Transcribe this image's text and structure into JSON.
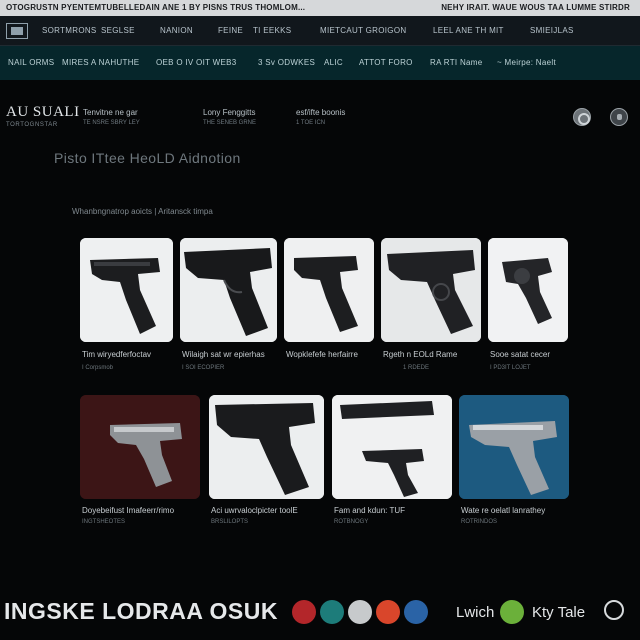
{
  "topbar": {
    "left_text": "OTOGRUSTN PYENTEMTUBELLEDAIN ANE 1 BY PISNS TRUS THOMLOM...",
    "right_text": "NEHY IRAIT.  WAUE WOUS TAA LUMME STIRDR"
  },
  "nav_primary": {
    "logo_icon": "site-logo-icon",
    "items": [
      "SORTMRONS",
      "SEGLSE",
      "NANION",
      "FEINE",
      "TI EEKKS",
      "MIETCAUT GROIGON",
      "LEEL ANE TH MIT",
      "SMIEIJLAS"
    ]
  },
  "nav_secondary": {
    "items": [
      "NAIL ORMS",
      "MIRES A NAHUTHE",
      "OEB O IV OIT WEB3",
      "3 Sv ODWKES",
      "ALIC",
      "ATTOT FORO",
      "RA RTI Name",
      "~ Meirpe: Naelt"
    ]
  },
  "header": {
    "brand_name": "AU SUALI",
    "brand_sub": "TORTOGNSTAR",
    "columns": [
      {
        "title": "Tenvitne ne gar",
        "sub": "TE NSRE SBRY LEY"
      },
      {
        "title": "Lony Fenggitts",
        "sub": "THE SENEB GRNE"
      },
      {
        "title": "esf/ifte boonis",
        "sub": "1 TOE ICN"
      }
    ],
    "icons": [
      "search-icon",
      "account-icon"
    ]
  },
  "main": {
    "title": "Pisto ITtee HeoLD Aidnotion",
    "breadcrumb": "Whanbngnatrop aoicts  |  Aritansck timpa"
  },
  "products_row1": [
    {
      "caption": "Tim wiryedferfoctav",
      "meta_left": "I  Corpsmob",
      "meta_right": ""
    },
    {
      "caption": "Wilaigh sat wr epierhas",
      "meta_left": "I  SOI ECOPIER",
      "meta_right": ""
    },
    {
      "caption": "Wopklefefe herfairre",
      "meta_left": "",
      "meta_right": ""
    },
    {
      "caption": "Rgeth n EOLd Rame",
      "meta_left": "",
      "meta_right": "1 RDEDE"
    },
    {
      "caption": "Sooe satat cecer",
      "meta_left": "I  PD3IT LOJET",
      "meta_right": ""
    }
  ],
  "products_row2": [
    {
      "caption": "Doyebeifust Imafeerr/rimo",
      "meta_left": "INGTSHEOTES",
      "meta_right": ""
    },
    {
      "caption": "Aci uwrvaloclpicter toolE",
      "meta_left": "BRSLILOPTS",
      "meta_right": ""
    },
    {
      "caption": "Fam and kdun: TUF",
      "meta_left": "ROTBNOGY",
      "meta_right": ""
    },
    {
      "caption": "Wate re oelatl lanrathey",
      "meta_left": "ROTRINDOS",
      "meta_right": ""
    }
  ],
  "footer": {
    "brand": "INGSKE LODRAA OSUK",
    "icons": [
      "red-target-icon",
      "teal-badge-icon",
      "red-shop-icon",
      "multicolor-icon",
      "blue-drop-icon",
      "green-badge-icon"
    ],
    "labels": [
      "Lwich",
      "Kty Tale"
    ],
    "end_icon": "crosshair-icon"
  },
  "colors": {
    "background": "#050607",
    "nav_secondary": "#06262b",
    "accent_blue": "#1e5e86"
  }
}
